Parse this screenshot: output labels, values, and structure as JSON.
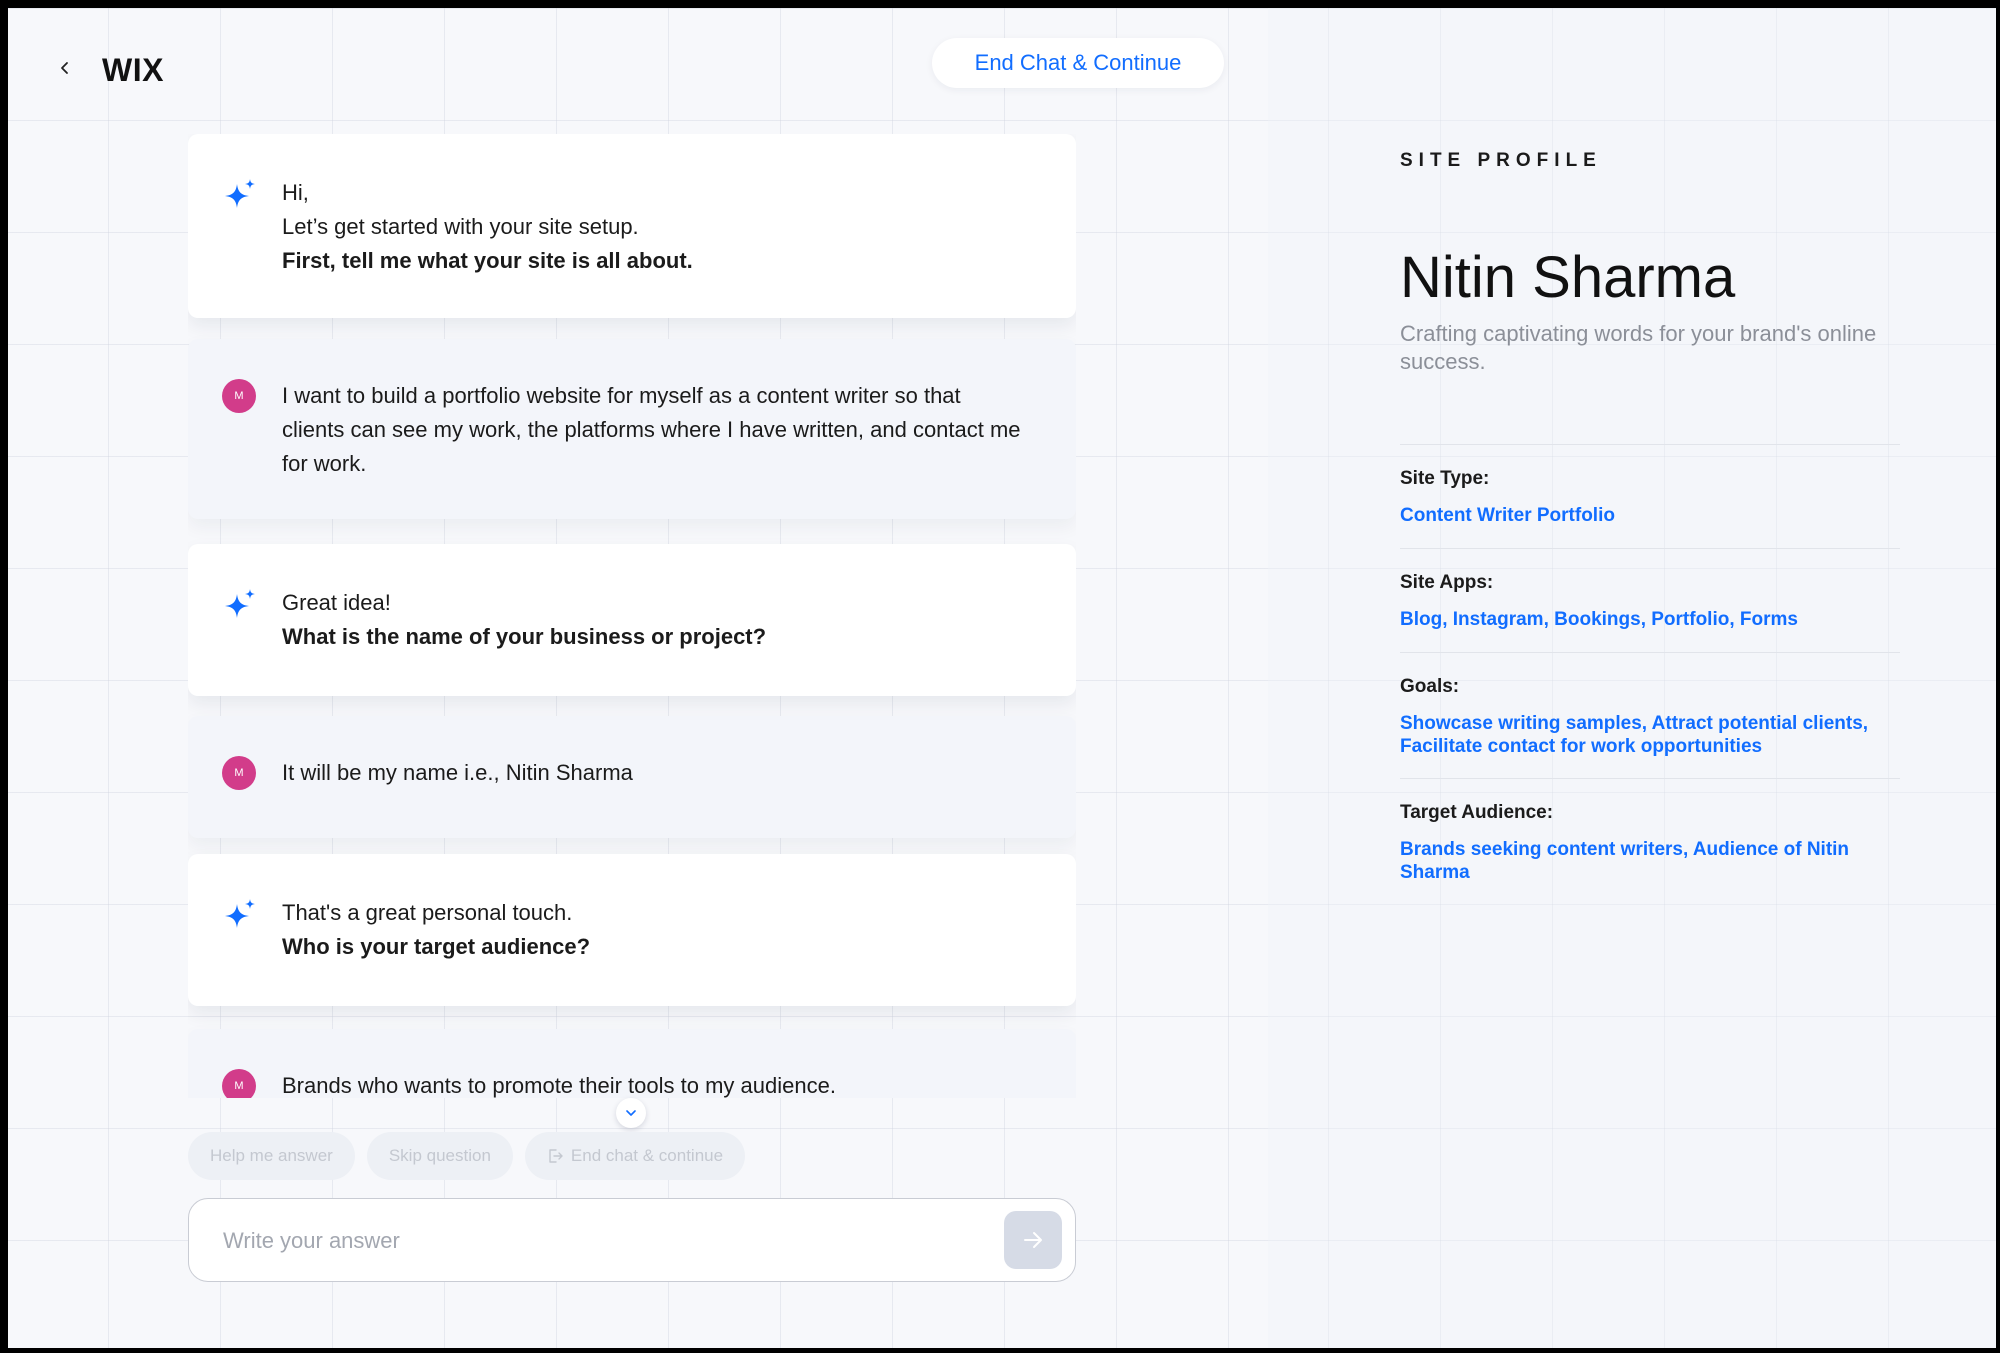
{
  "header": {
    "back_icon": "chevron-left-icon",
    "logo": "WIX",
    "end_chat_label": "End Chat & Continue"
  },
  "chat": {
    "messages": [
      {
        "role": "ai",
        "lines": [
          "Hi,",
          "Let’s get started with your site setup."
        ],
        "bold": "First, tell me what your site is all about."
      },
      {
        "role": "user",
        "avatar": "M",
        "text": "I want to build a portfolio website for myself as a content writer so that clients can see my work, the platforms where I have written, and contact me for work."
      },
      {
        "role": "ai",
        "lines": [
          "Great idea!"
        ],
        "bold": "What is the name of your business or project?"
      },
      {
        "role": "user",
        "avatar": "M",
        "text": "It will be my name i.e., Nitin Sharma"
      },
      {
        "role": "ai",
        "lines": [
          "That's a great personal touch."
        ],
        "bold": "Who is your target audience?"
      },
      {
        "role": "user",
        "avatar": "M",
        "text": "Brands who wants to promote their tools to my audience."
      }
    ],
    "chips": [
      "Help me answer",
      "Skip question",
      "End chat & continue"
    ],
    "input_placeholder": "Write your answer",
    "accent_color": "#116dff",
    "avatar_color": "#d23c8a"
  },
  "profile": {
    "heading": "SITE PROFILE",
    "name": "Nitin Sharma",
    "tagline": "Crafting captivating words for your brand's online success.",
    "fields": [
      {
        "label": "Site Type:",
        "value": "Content Writer Portfolio"
      },
      {
        "label": "Site Apps:",
        "value": "Blog, Instagram, Bookings, Portfolio, Forms"
      },
      {
        "label": "Goals:",
        "value": "Showcase writing samples, Attract potential clients, Facilitate contact for work opportunities"
      },
      {
        "label": "Target Audience:",
        "value": "Brands seeking content writers, Audience of Nitin Sharma"
      }
    ]
  }
}
